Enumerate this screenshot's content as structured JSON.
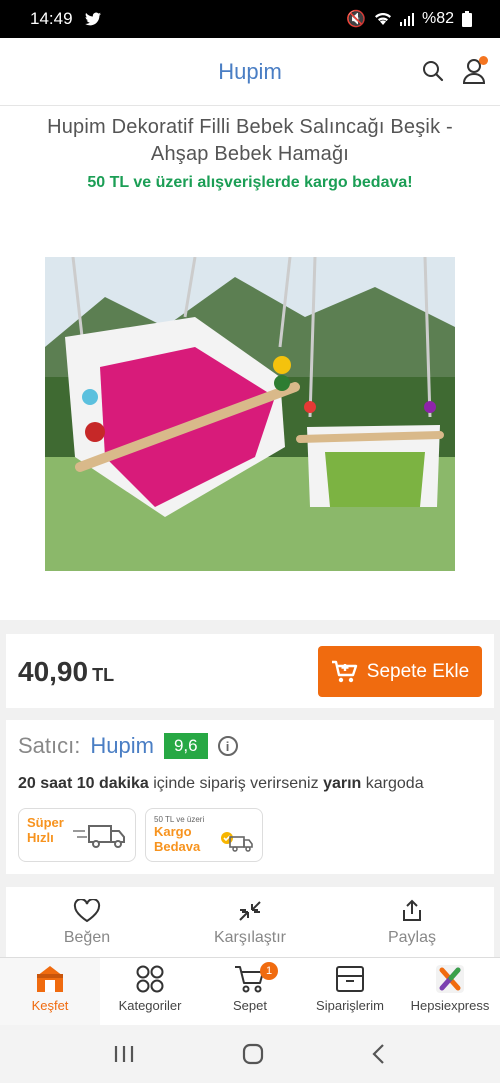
{
  "status": {
    "time": "14:49",
    "battery": "%82"
  },
  "header": {
    "brand": "Hupim"
  },
  "product": {
    "title": "Hupim Dekoratif Filli Bebek Salıncağı Beşik - Ahşap Bebek Hamağı",
    "promo": "50 TL ve üzeri alışverişlerde kargo bedava!",
    "price": "40,90",
    "currency": "TL",
    "add_to_cart": "Sepete Ekle"
  },
  "seller": {
    "label": "Satıcı:",
    "name": "Hupim",
    "score": "9,6",
    "ship_time": "20 saat 10 dakika",
    "ship_mid": "içinde sipariş verirseniz",
    "ship_day": "yarın",
    "ship_end": "kargoda",
    "badge_fast_1": "Süper",
    "badge_fast_2": "Hızlı",
    "badge_free_small": "50 TL ve üzeri",
    "badge_free_1": "Kargo",
    "badge_free_2": "Bedava"
  },
  "actions": {
    "like": "Beğen",
    "compare": "Karşılaştır",
    "share": "Paylaş"
  },
  "tabs": {
    "explore": "Keşfet",
    "categories": "Kategoriler",
    "cart": "Sepet",
    "cart_count": "1",
    "orders": "Siparişlerim",
    "express": "Hepsiexpress"
  },
  "colors": {
    "brand_blue": "#4a7ec4",
    "accent_orange": "#f06b0f",
    "promo_green": "#1b9e55",
    "score_green": "#27a844"
  }
}
